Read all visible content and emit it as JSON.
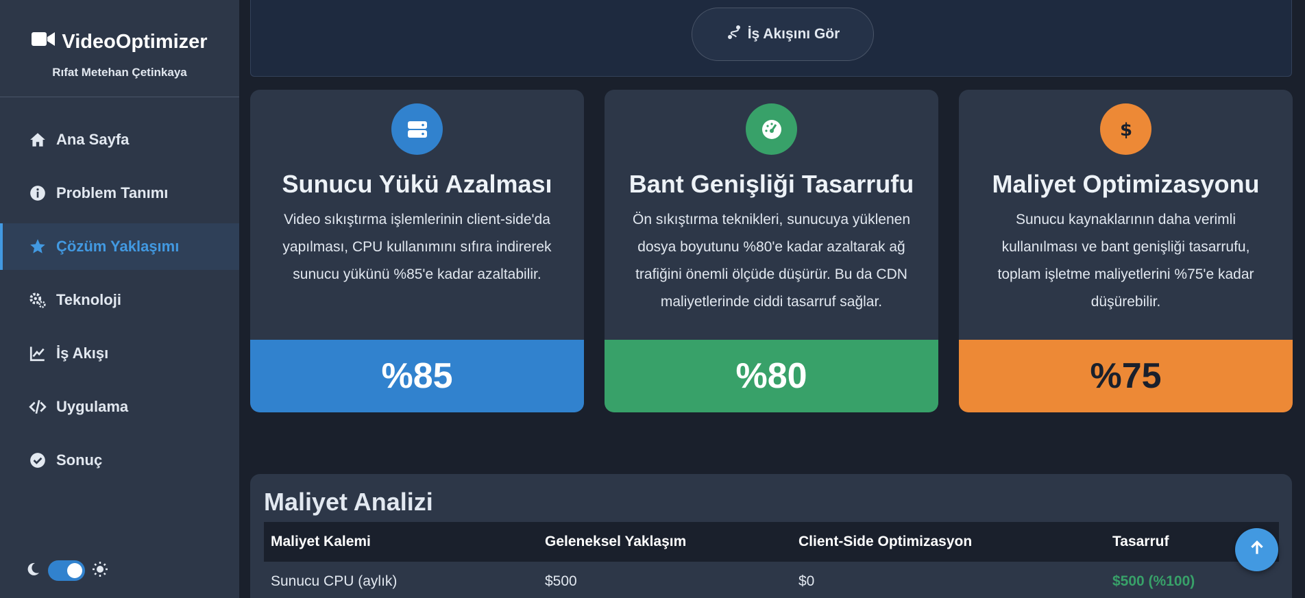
{
  "brand": {
    "title": "VideoOptimizer",
    "subtitle": "Rıfat Metehan Çetinkaya",
    "icon": "video-camera-icon"
  },
  "nav": [
    {
      "label": "Ana Sayfa",
      "icon": "home-icon",
      "active": false
    },
    {
      "label": "Problem Tanımı",
      "icon": "info-circle-icon",
      "active": false
    },
    {
      "label": "Çözüm Yaklaşımı",
      "icon": "star-icon",
      "active": true
    },
    {
      "label": "Teknoloji",
      "icon": "gears-icon",
      "active": false
    },
    {
      "label": "İş Akışı",
      "icon": "line-chart-icon",
      "active": false
    },
    {
      "label": "Uygulama",
      "icon": "code-icon",
      "active": false
    },
    {
      "label": "Sonuç",
      "icon": "check-circle-icon",
      "active": false
    }
  ],
  "theme": {
    "dark_icon": "moon-icon",
    "light_icon": "sun-icon",
    "toggle_on": true
  },
  "flow_button": {
    "label": "İş Akışını Gör",
    "icon": "route-icon"
  },
  "cards": [
    {
      "title": "Sunucu Yükü Azalması",
      "description": "Video sıkıştırma işlemlerinin client-side'da yapılması, CPU kullanımını sıfıra indirerek sunucu yükünü %85'e kadar azaltabilir.",
      "stat": "%85",
      "icon": "server-icon",
      "color": "#3182ce"
    },
    {
      "title": "Bant Genişliği Tasarrufu",
      "description": "Ön sıkıştırma teknikleri, sunucuya yüklenen dosya boyutunu %80'e kadar azaltarak ağ trafiğini önemli ölçüde düşürür. Bu da CDN maliyetlerinde ciddi tasarruf sağlar.",
      "stat": "%80",
      "icon": "gauge-icon",
      "color": "#38a169"
    },
    {
      "title": "Maliyet Optimizasyonu",
      "description": "Sunucu kaynaklarının daha verimli kullanılması ve bant genişliği tasarrufu, toplam işletme maliyetlerini %75'e kadar düşürebilir.",
      "stat": "%75",
      "icon": "dollar-icon",
      "color": "#ed8936"
    }
  ],
  "analysis": {
    "title": "Maliyet Analizi",
    "headers": [
      "Maliyet Kalemi",
      "Geleneksel Yaklaşım",
      "Client-Side Optimizasyon",
      "Tasarruf"
    ],
    "rows": [
      [
        "Sunucu CPU (aylık)",
        "$500",
        "$0",
        "$500 (%100)"
      ]
    ]
  },
  "scroll_top": {
    "icon": "arrow-up-icon"
  },
  "colors": {
    "accent": "#4299e1",
    "sidebar": "#2d3748",
    "background": "#1a202c",
    "success": "#38a169"
  }
}
